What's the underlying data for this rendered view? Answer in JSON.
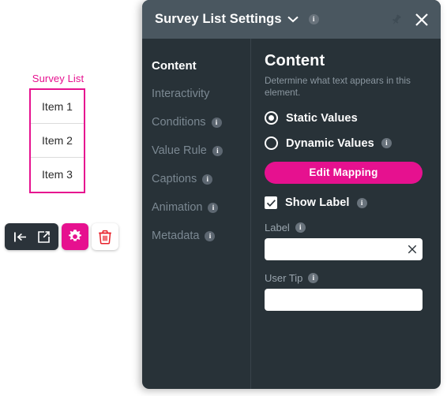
{
  "canvas": {
    "widget": {
      "label": "Survey List",
      "items": [
        "Item 1",
        "Item 2",
        "Item 3"
      ],
      "accent_color": "#e6118f"
    },
    "toolbar": {
      "snap_icon": "align-left-icon",
      "open_icon": "external-link-icon",
      "settings_icon": "gear-icon",
      "delete_icon": "trash-icon"
    }
  },
  "panel": {
    "header": {
      "title": "Survey List Settings",
      "chevron_icon": "chevron-down-icon",
      "info_icon": "info-icon",
      "pin_icon": "pin-icon",
      "close_icon": "close-icon",
      "background_color": "#4a5760"
    },
    "nav": {
      "items": [
        {
          "label": "Content",
          "active": true,
          "info": false
        },
        {
          "label": "Interactivity",
          "active": false,
          "info": false
        },
        {
          "label": "Conditions",
          "active": false,
          "info": true
        },
        {
          "label": "Value Rule",
          "active": false,
          "info": true
        },
        {
          "label": "Captions",
          "active": false,
          "info": true
        },
        {
          "label": "Animation",
          "active": false,
          "info": true
        },
        {
          "label": "Metadata",
          "active": false,
          "info": true
        }
      ]
    },
    "content": {
      "title": "Content",
      "description": "Determine what text appears in this element.",
      "value_mode": {
        "static": {
          "label": "Static Values",
          "selected": true
        },
        "dynamic": {
          "label": "Dynamic Values",
          "selected": false
        }
      },
      "edit_mapping_label": "Edit Mapping",
      "edit_mapping_color": "#e6118f",
      "show_label": {
        "label": "Show Label",
        "checked": true
      },
      "label_field": {
        "label": "Label",
        "value": "",
        "placeholder": ""
      },
      "user_tip_field": {
        "label": "User Tip",
        "value": "",
        "placeholder": ""
      }
    }
  }
}
